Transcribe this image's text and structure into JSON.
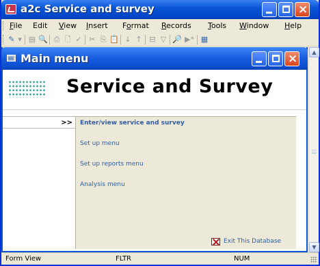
{
  "app": {
    "title": "a2c Service and survey"
  },
  "menubar": [
    {
      "pre": "",
      "key": "F",
      "post": "ile"
    },
    {
      "pre": "",
      "key": "",
      "post": "Edit"
    },
    {
      "pre": "",
      "key": "V",
      "post": "iew"
    },
    {
      "pre": "",
      "key": "I",
      "post": "nsert"
    },
    {
      "pre": "F",
      "key": "o",
      "post": "rmat"
    },
    {
      "pre": "",
      "key": "R",
      "post": "ecords"
    },
    {
      "pre": "",
      "key": "T",
      "post": "ools"
    },
    {
      "pre": "",
      "key": "W",
      "post": "indow"
    },
    {
      "pre": "",
      "key": "H",
      "post": "elp"
    }
  ],
  "toolbar": {
    "icons": [
      "design-view-icon",
      "dropdown-arrow-icon",
      "save-icon",
      "file-search-icon",
      "print-icon",
      "print-preview-icon",
      "spelling-icon",
      "cut-icon",
      "copy-icon",
      "paste-icon",
      "sort-ascending-icon",
      "sort-descending-icon",
      "filter-by-selection-icon",
      "filter-by-form-icon",
      "find-icon",
      "new-record-icon",
      "database-window-icon"
    ],
    "glyphs": [
      "✎",
      "▾",
      "▤",
      "🔍",
      "⎙",
      "🗋",
      "✓",
      "✂",
      "⎘",
      "📋",
      "↓",
      "↑",
      "⊟",
      "▽",
      "🔎",
      "▶*",
      "▦"
    ]
  },
  "inner_window": {
    "title": "Main menu"
  },
  "form": {
    "banner": "Service and Survey",
    "marker": ">>",
    "items": [
      {
        "label": "Enter/view service and survey",
        "active": true
      },
      {
        "label": "Set up menu",
        "active": false
      },
      {
        "label": "Set up reports menu",
        "active": false
      },
      {
        "label": "Analysis menu",
        "active": false
      }
    ],
    "exit_label": "Exit This Database"
  },
  "statusbar": {
    "view": "Form View",
    "filter": "FLTR",
    "num": "NUM"
  },
  "colors": {
    "titlebar": "#0a57d6",
    "link": "#2f5da8",
    "dots": "#2ea59a"
  }
}
